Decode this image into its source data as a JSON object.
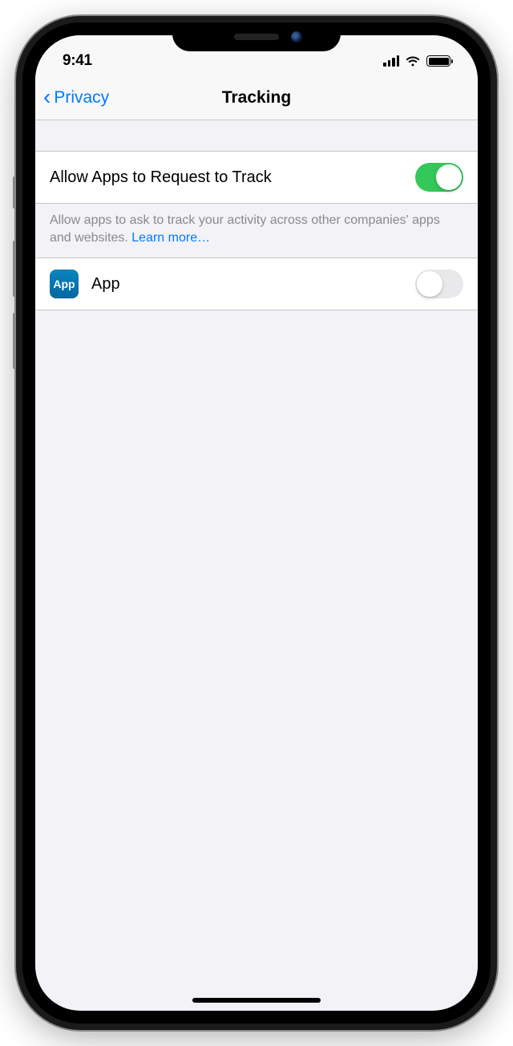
{
  "statusBar": {
    "time": "9:41"
  },
  "navBar": {
    "backLabel": "Privacy",
    "title": "Tracking"
  },
  "allowTracking": {
    "label": "Allow Apps to Request to Track",
    "footer": "Allow apps to ask to track your activity across other companies' apps and websites. ",
    "learnMore": "Learn more…",
    "enabled": true
  },
  "apps": [
    {
      "iconLabel": "App",
      "name": "App",
      "enabled": false
    }
  ]
}
